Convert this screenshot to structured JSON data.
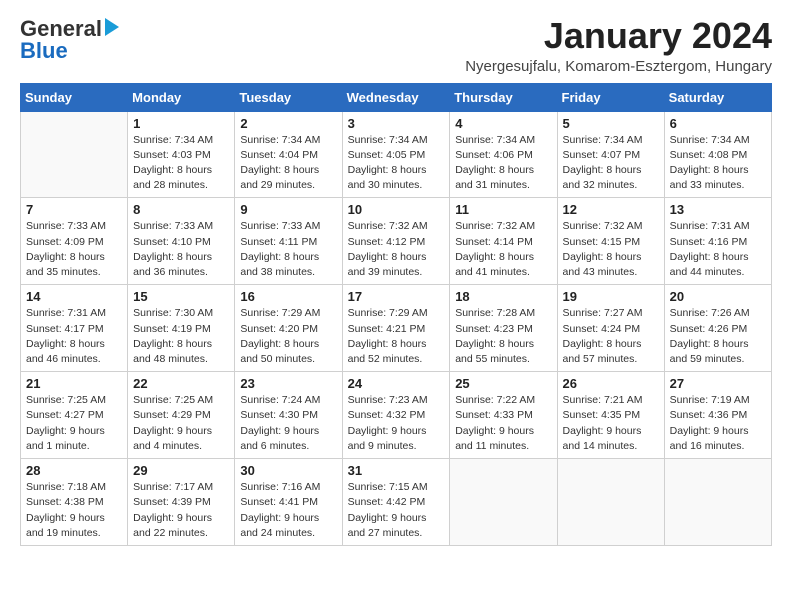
{
  "header": {
    "logo_general": "General",
    "logo_blue": "Blue",
    "month_title": "January 2024",
    "location": "Nyergesujfalu, Komarom-Esztergom, Hungary"
  },
  "weekdays": [
    "Sunday",
    "Monday",
    "Tuesday",
    "Wednesday",
    "Thursday",
    "Friday",
    "Saturday"
  ],
  "weeks": [
    [
      {
        "day": "",
        "info": ""
      },
      {
        "day": "1",
        "info": "Sunrise: 7:34 AM\nSunset: 4:03 PM\nDaylight: 8 hours\nand 28 minutes."
      },
      {
        "day": "2",
        "info": "Sunrise: 7:34 AM\nSunset: 4:04 PM\nDaylight: 8 hours\nand 29 minutes."
      },
      {
        "day": "3",
        "info": "Sunrise: 7:34 AM\nSunset: 4:05 PM\nDaylight: 8 hours\nand 30 minutes."
      },
      {
        "day": "4",
        "info": "Sunrise: 7:34 AM\nSunset: 4:06 PM\nDaylight: 8 hours\nand 31 minutes."
      },
      {
        "day": "5",
        "info": "Sunrise: 7:34 AM\nSunset: 4:07 PM\nDaylight: 8 hours\nand 32 minutes."
      },
      {
        "day": "6",
        "info": "Sunrise: 7:34 AM\nSunset: 4:08 PM\nDaylight: 8 hours\nand 33 minutes."
      }
    ],
    [
      {
        "day": "7",
        "info": "Sunrise: 7:33 AM\nSunset: 4:09 PM\nDaylight: 8 hours\nand 35 minutes."
      },
      {
        "day": "8",
        "info": "Sunrise: 7:33 AM\nSunset: 4:10 PM\nDaylight: 8 hours\nand 36 minutes."
      },
      {
        "day": "9",
        "info": "Sunrise: 7:33 AM\nSunset: 4:11 PM\nDaylight: 8 hours\nand 38 minutes."
      },
      {
        "day": "10",
        "info": "Sunrise: 7:32 AM\nSunset: 4:12 PM\nDaylight: 8 hours\nand 39 minutes."
      },
      {
        "day": "11",
        "info": "Sunrise: 7:32 AM\nSunset: 4:14 PM\nDaylight: 8 hours\nand 41 minutes."
      },
      {
        "day": "12",
        "info": "Sunrise: 7:32 AM\nSunset: 4:15 PM\nDaylight: 8 hours\nand 43 minutes."
      },
      {
        "day": "13",
        "info": "Sunrise: 7:31 AM\nSunset: 4:16 PM\nDaylight: 8 hours\nand 44 minutes."
      }
    ],
    [
      {
        "day": "14",
        "info": "Sunrise: 7:31 AM\nSunset: 4:17 PM\nDaylight: 8 hours\nand 46 minutes."
      },
      {
        "day": "15",
        "info": "Sunrise: 7:30 AM\nSunset: 4:19 PM\nDaylight: 8 hours\nand 48 minutes."
      },
      {
        "day": "16",
        "info": "Sunrise: 7:29 AM\nSunset: 4:20 PM\nDaylight: 8 hours\nand 50 minutes."
      },
      {
        "day": "17",
        "info": "Sunrise: 7:29 AM\nSunset: 4:21 PM\nDaylight: 8 hours\nand 52 minutes."
      },
      {
        "day": "18",
        "info": "Sunrise: 7:28 AM\nSunset: 4:23 PM\nDaylight: 8 hours\nand 55 minutes."
      },
      {
        "day": "19",
        "info": "Sunrise: 7:27 AM\nSunset: 4:24 PM\nDaylight: 8 hours\nand 57 minutes."
      },
      {
        "day": "20",
        "info": "Sunrise: 7:26 AM\nSunset: 4:26 PM\nDaylight: 8 hours\nand 59 minutes."
      }
    ],
    [
      {
        "day": "21",
        "info": "Sunrise: 7:25 AM\nSunset: 4:27 PM\nDaylight: 9 hours\nand 1 minute."
      },
      {
        "day": "22",
        "info": "Sunrise: 7:25 AM\nSunset: 4:29 PM\nDaylight: 9 hours\nand 4 minutes."
      },
      {
        "day": "23",
        "info": "Sunrise: 7:24 AM\nSunset: 4:30 PM\nDaylight: 9 hours\nand 6 minutes."
      },
      {
        "day": "24",
        "info": "Sunrise: 7:23 AM\nSunset: 4:32 PM\nDaylight: 9 hours\nand 9 minutes."
      },
      {
        "day": "25",
        "info": "Sunrise: 7:22 AM\nSunset: 4:33 PM\nDaylight: 9 hours\nand 11 minutes."
      },
      {
        "day": "26",
        "info": "Sunrise: 7:21 AM\nSunset: 4:35 PM\nDaylight: 9 hours\nand 14 minutes."
      },
      {
        "day": "27",
        "info": "Sunrise: 7:19 AM\nSunset: 4:36 PM\nDaylight: 9 hours\nand 16 minutes."
      }
    ],
    [
      {
        "day": "28",
        "info": "Sunrise: 7:18 AM\nSunset: 4:38 PM\nDaylight: 9 hours\nand 19 minutes."
      },
      {
        "day": "29",
        "info": "Sunrise: 7:17 AM\nSunset: 4:39 PM\nDaylight: 9 hours\nand 22 minutes."
      },
      {
        "day": "30",
        "info": "Sunrise: 7:16 AM\nSunset: 4:41 PM\nDaylight: 9 hours\nand 24 minutes."
      },
      {
        "day": "31",
        "info": "Sunrise: 7:15 AM\nSunset: 4:42 PM\nDaylight: 9 hours\nand 27 minutes."
      },
      {
        "day": "",
        "info": ""
      },
      {
        "day": "",
        "info": ""
      },
      {
        "day": "",
        "info": ""
      }
    ]
  ]
}
